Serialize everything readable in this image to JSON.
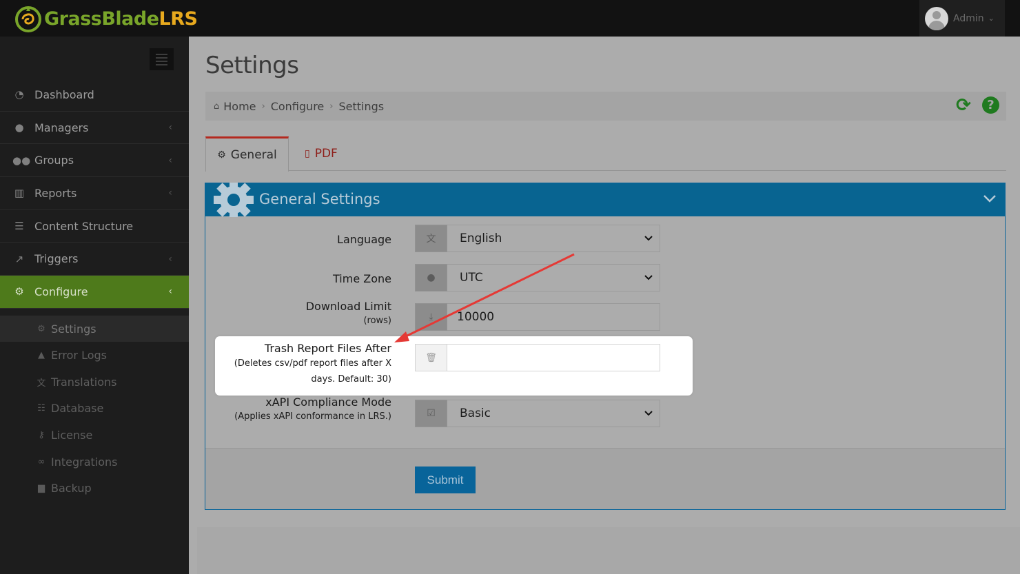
{
  "app": {
    "logo_text_green": "GrassBlade",
    "logo_text_orange": "LRS",
    "user_name": "Admin"
  },
  "colors": {
    "accent_green": "#4e7a1b",
    "header_blue": "#086491",
    "annotation_arrow": "#e53935",
    "tab_active_border": "#b4291f"
  },
  "sidebar": {
    "items": [
      {
        "label": "Dashboard",
        "icon": "dashboard-icon",
        "has_chevron": false
      },
      {
        "label": "Managers",
        "icon": "user-icon",
        "has_chevron": true
      },
      {
        "label": "Groups",
        "icon": "users-icon",
        "has_chevron": true
      },
      {
        "label": "Reports",
        "icon": "bar-chart-icon",
        "has_chevron": true
      },
      {
        "label": "Content Structure",
        "icon": "list-icon",
        "has_chevron": false
      },
      {
        "label": "Triggers",
        "icon": "external-link-icon",
        "has_chevron": true
      },
      {
        "label": "Configure",
        "icon": "gear-icon",
        "has_chevron": true,
        "active": true
      }
    ],
    "subitems": [
      {
        "label": "Settings",
        "icon": "gear-icon",
        "current": true
      },
      {
        "label": "Error Logs",
        "icon": "warning-icon"
      },
      {
        "label": "Translations",
        "icon": "language-icon"
      },
      {
        "label": "Database",
        "icon": "database-icon"
      },
      {
        "label": "License",
        "icon": "key-icon"
      },
      {
        "label": "Integrations",
        "icon": "link-icon"
      },
      {
        "label": "Backup",
        "icon": "archive-icon"
      }
    ]
  },
  "page": {
    "title": "Settings",
    "breadcrumb": [
      "Home",
      "Configure",
      "Settings"
    ]
  },
  "tabs": [
    {
      "label": "General",
      "icon": "gear-icon",
      "active": true
    },
    {
      "label": "PDF",
      "icon": "file-pdf-icon",
      "active": false
    }
  ],
  "panel": {
    "title": "General Settings",
    "fields": {
      "language": {
        "label": "Language",
        "value": "English",
        "icon": "language-icon"
      },
      "timezone": {
        "label": "Time Zone",
        "value": "UTC",
        "icon": "globe-icon"
      },
      "download_limit": {
        "label": "Download Limit",
        "sub": "(rows)",
        "value": "10000",
        "icon": "download-icon"
      },
      "trash_after": {
        "label": "Trash Report Files After",
        "sub_line1": "(Deletes csv/pdf report files after X",
        "sub_line2": "days. Default: 30)",
        "value": "",
        "icon": "trash-icon"
      },
      "xapi_mode": {
        "label": "xAPI Compliance Mode",
        "sub": "(Applies xAPI conformance in LRS.)",
        "value": "Basic",
        "icon": "check-square-icon"
      }
    },
    "submit_label": "Submit"
  }
}
